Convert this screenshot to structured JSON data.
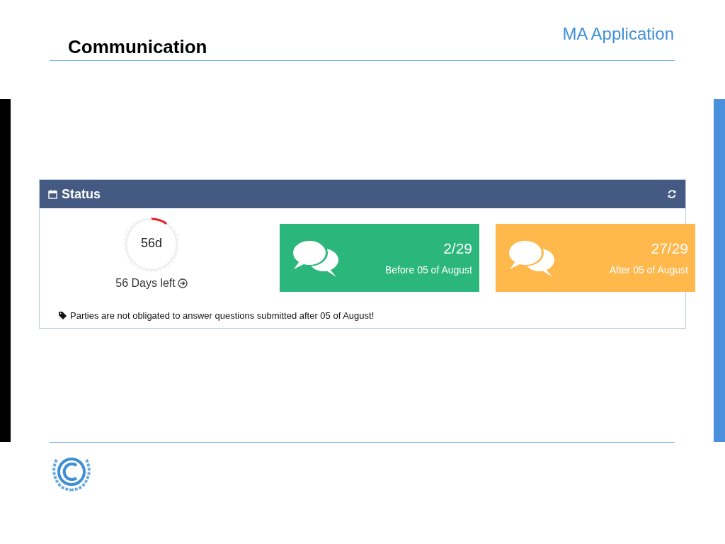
{
  "slide": {
    "title": "Communication",
    "app_label": "MA Application"
  },
  "panel": {
    "title": "Status",
    "countdown": {
      "value": "56d",
      "level": 0.1,
      "caption": "56 Days left"
    },
    "tiles": [
      {
        "count": "2/29",
        "label": "Before 05 of August",
        "color": "#2bb67b"
      },
      {
        "count": "27/29",
        "label": "After 05 of August",
        "color": "#feb84c"
      }
    ],
    "note": "Parties are not obligated to answer questions submitted after 05 of August!"
  }
}
